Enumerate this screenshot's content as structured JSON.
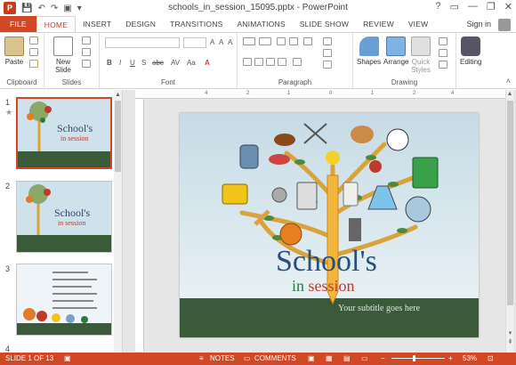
{
  "window": {
    "title": "schools_in_session_15095.pptx - PowerPoint"
  },
  "tabs": [
    "FILE",
    "HOME",
    "INSERT",
    "DESIGN",
    "TRANSITIONS",
    "ANIMATIONS",
    "SLIDE SHOW",
    "REVIEW",
    "VIEW"
  ],
  "account": {
    "signin": "Sign in"
  },
  "ribbon": {
    "paste": "Paste",
    "new_slide": "New Slide",
    "shapes": "Shapes",
    "arrange": "Arrange",
    "quick_styles": "Quick Styles",
    "editing": "Editing",
    "groups": [
      "Clipboard",
      "Slides",
      "Font",
      "Paragraph",
      "Drawing"
    ]
  },
  "thumbs": [
    {
      "num": "1",
      "title": "School's",
      "sub": "in session"
    },
    {
      "num": "2",
      "title": "School's",
      "sub": "in session"
    },
    {
      "num": "3"
    },
    {
      "num": "4"
    }
  ],
  "slide": {
    "title": "School's",
    "line2_a": "in",
    "line2_b": "session",
    "subtitle": "Your subtitle goes here"
  },
  "status": {
    "slide_info": "SLIDE 1 OF 13",
    "notes": "NOTES",
    "comments": "COMMENTS",
    "zoom": "53%"
  },
  "colors": {
    "accent": "#d24726",
    "slide_bg": "#cfe1ea",
    "band": "#3a5a3a"
  }
}
